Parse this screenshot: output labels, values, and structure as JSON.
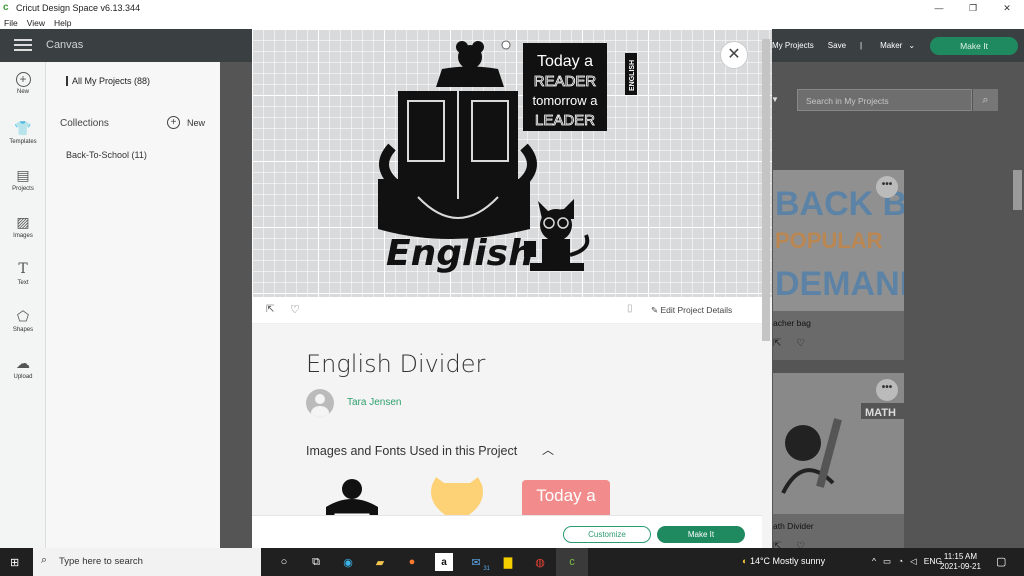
{
  "window": {
    "title": "Cricut Design Space  v6.13.344",
    "minimize": "—",
    "restore": "❐",
    "close": "✕"
  },
  "menu": [
    "File",
    "View",
    "Help"
  ],
  "topnav": {
    "canvas": "Canvas",
    "my_projects": "My Projects",
    "save": "Save",
    "divider": "|",
    "machine": "Maker",
    "make_it": "Make It"
  },
  "rail": [
    {
      "label": "New",
      "icon": "plus-circle-icon"
    },
    {
      "label": "Templates",
      "icon": "shirt-icon"
    },
    {
      "label": "Projects",
      "icon": "projects-icon"
    },
    {
      "label": "Images",
      "icon": "image-icon"
    },
    {
      "label": "Text",
      "icon": "text-icon"
    },
    {
      "label": "Shapes",
      "icon": "shapes-icon"
    },
    {
      "label": "Upload",
      "icon": "upload-icon"
    }
  ],
  "projects_panel": {
    "all": "All My Projects (88)",
    "collections": "Collections",
    "new": "New",
    "collection_1": "Back-To-School (11)"
  },
  "search": {
    "placeholder": "Search in My Projects"
  },
  "cards": [
    {
      "title": "acher bag",
      "thumb_text": "BACK BY POPULAR DEMAND"
    },
    {
      "title": "ath Divider",
      "thumb_text": "MATH"
    }
  ],
  "modal": {
    "hero_texts": {
      "banner": "Today a READER tomorrow a LEADER",
      "english_vertical": "ENGLISH",
      "word": "English"
    },
    "edit_details": "Edit Project Details",
    "title": "English Divider",
    "author": "Tara Jensen",
    "section": "Images and Fonts Used in this Project",
    "thumb_text": "Today a",
    "customize": "Customize",
    "make_it": "Make It"
  },
  "taskbar": {
    "search": "Type here to search",
    "weather": "14°C  Mostly sunny",
    "lang": "ENG",
    "time": "11:15 AM",
    "date": "2021-09-21",
    "calendar_day": "31"
  },
  "colors": {
    "accent": "#1f8a5f",
    "nav": "#3a3f41",
    "author": "#2e9f6d"
  }
}
